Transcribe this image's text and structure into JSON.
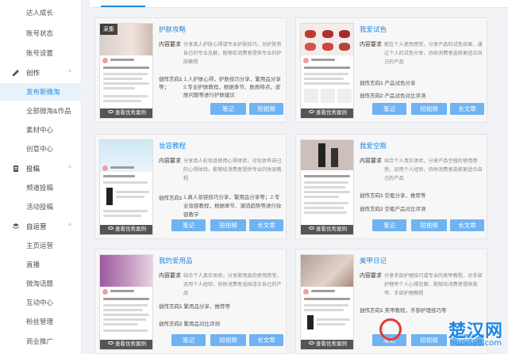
{
  "sidebar": {
    "items": [
      {
        "label": "达人成长"
      },
      {
        "label": "账号状态"
      },
      {
        "label": "账号设置"
      },
      {
        "label": "创作",
        "section": true,
        "icon": "pencil-icon"
      },
      {
        "label": "发布新微淘",
        "active": true
      },
      {
        "label": "全部微淘&作品"
      },
      {
        "label": "素材中心"
      },
      {
        "label": "创意中心"
      },
      {
        "label": "投稿",
        "section": true,
        "icon": "document-icon"
      },
      {
        "label": "频道投稿"
      },
      {
        "label": "活动投稿"
      },
      {
        "label": "自运营",
        "section": true,
        "icon": "stack-icon"
      },
      {
        "label": "主页运营"
      },
      {
        "label": "直播"
      },
      {
        "label": "微淘话题"
      },
      {
        "label": "互动中心"
      },
      {
        "label": "粉丝管理"
      },
      {
        "label": "商业推广"
      }
    ]
  },
  "labels": {
    "req": "内容要求",
    "dir1": "创作方向1",
    "dir2": "创作方向2",
    "see_cases": "查看优秀案例",
    "btn_note": "笔记",
    "btn_short": "短视频",
    "btn_long": "长文章"
  },
  "cards": [
    {
      "title": "护肤攻略",
      "requirement": "分享真人护肤心得或专业护肤技巧，对护肤有自己的专业见解，能够给消费者提供专业的护肤教程",
      "dir1": "1.人护肤心得，护肤技巧分享，繁用品分享等；",
      "dir2": "2.专业护肤教程，根据季节、肤质特点，皮肤问题等进行护肤建议",
      "thumb_tag": "采集",
      "buttons": [
        "笔记",
        "短视频"
      ]
    },
    {
      "title": "我爱试色",
      "requirement": "能在个人使用感受，分享产品的试色效果，通过个人的试色分享，协助消费者选择更适合自己的产品",
      "dir1": "产品试色分享",
      "dir2": "产品试色对比评测",
      "buttons": [
        "笔记",
        "短视频",
        "长文章"
      ]
    },
    {
      "title": "妆容教程",
      "requirement": "分享真人彩妆品使用心得体验，对化妆有自己的心得体验，能够给消费者提供专业的妆容教程",
      "dir1": "1.真人妆容技巧分享，繁用品分享等；2.专业妆容教程，根据季节、潮流趋势等进行妆容教学",
      "dir2": "",
      "buttons": [
        "笔记",
        "短视频",
        "长文章"
      ]
    },
    {
      "title": "我爱空瓶",
      "requirement": "结合个人真实体验，分享产品空瓶的使用感受，运用个人经验，协助消费者选择更适合自己的产品",
      "dir1": "空瓶分享，推荐等",
      "dir2": "空瓶产品对比评测",
      "buttons": [
        "笔记",
        "短视频",
        "长文章"
      ]
    },
    {
      "title": "我的爱用品",
      "requirement": "结合个人真实体验，分享繁用品的使用感受，运用个人经验，协助消费者选择适合自己的产品",
      "dir1": "繁用品分享、推荐等",
      "dir2": "繁用品对比评测",
      "buttons": [
        "笔记",
        "短视频",
        "长文章"
      ]
    },
    {
      "title": "美甲日记",
      "requirement": "分享手部护理技巧或专业的美甲教程，对手部护理有个人心得见解，能够给消费者提供美甲、手部护理教程",
      "dir1": "美甲教程，手部护理技巧等",
      "dir2": "",
      "buttons": [
        "笔记",
        "短视频",
        "长文章"
      ]
    }
  ],
  "watermark": {
    "big": "楚汉网",
    "small": "hubei88.com"
  },
  "colors": {
    "accent": "#1e88e5",
    "button": "#6fb3f3"
  }
}
